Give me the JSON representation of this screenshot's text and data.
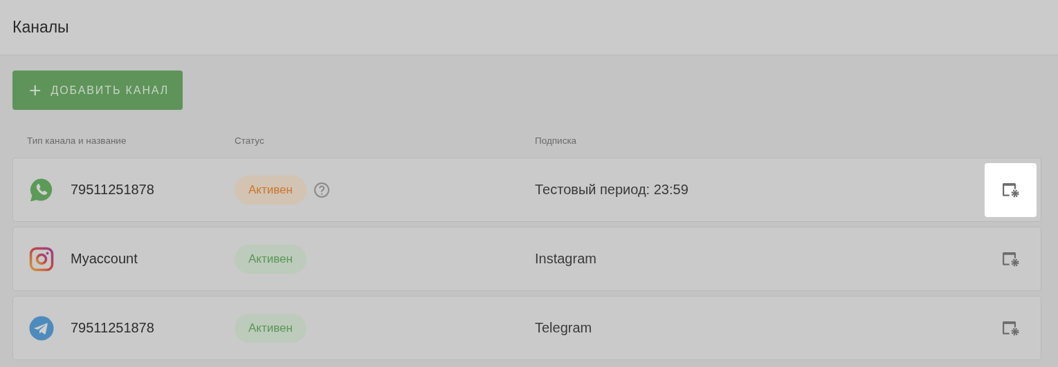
{
  "page": {
    "title": "Каналы"
  },
  "add_button": {
    "icon": "+",
    "label": "ДОБАВИТЬ КАНАЛ"
  },
  "columns": [
    "Тип канала и название",
    "Статус",
    "Подписка"
  ],
  "channels": [
    {
      "kind": "whatsapp",
      "name": "79511251878",
      "status": {
        "label": "Активен",
        "kind": "trial"
      },
      "help": true,
      "subscription": "Тестовый период: 23:59",
      "settings_highlighted": true
    },
    {
      "kind": "instagram",
      "name": "Myaccount",
      "status": {
        "label": "Активен",
        "kind": "active"
      },
      "help": false,
      "subscription": "Instagram",
      "settings_highlighted": false
    },
    {
      "kind": "telegram",
      "name": "79511251878",
      "status": {
        "label": "Активен",
        "kind": "active"
      },
      "help": false,
      "subscription": "Telegram",
      "settings_highlighted": false
    }
  ]
}
